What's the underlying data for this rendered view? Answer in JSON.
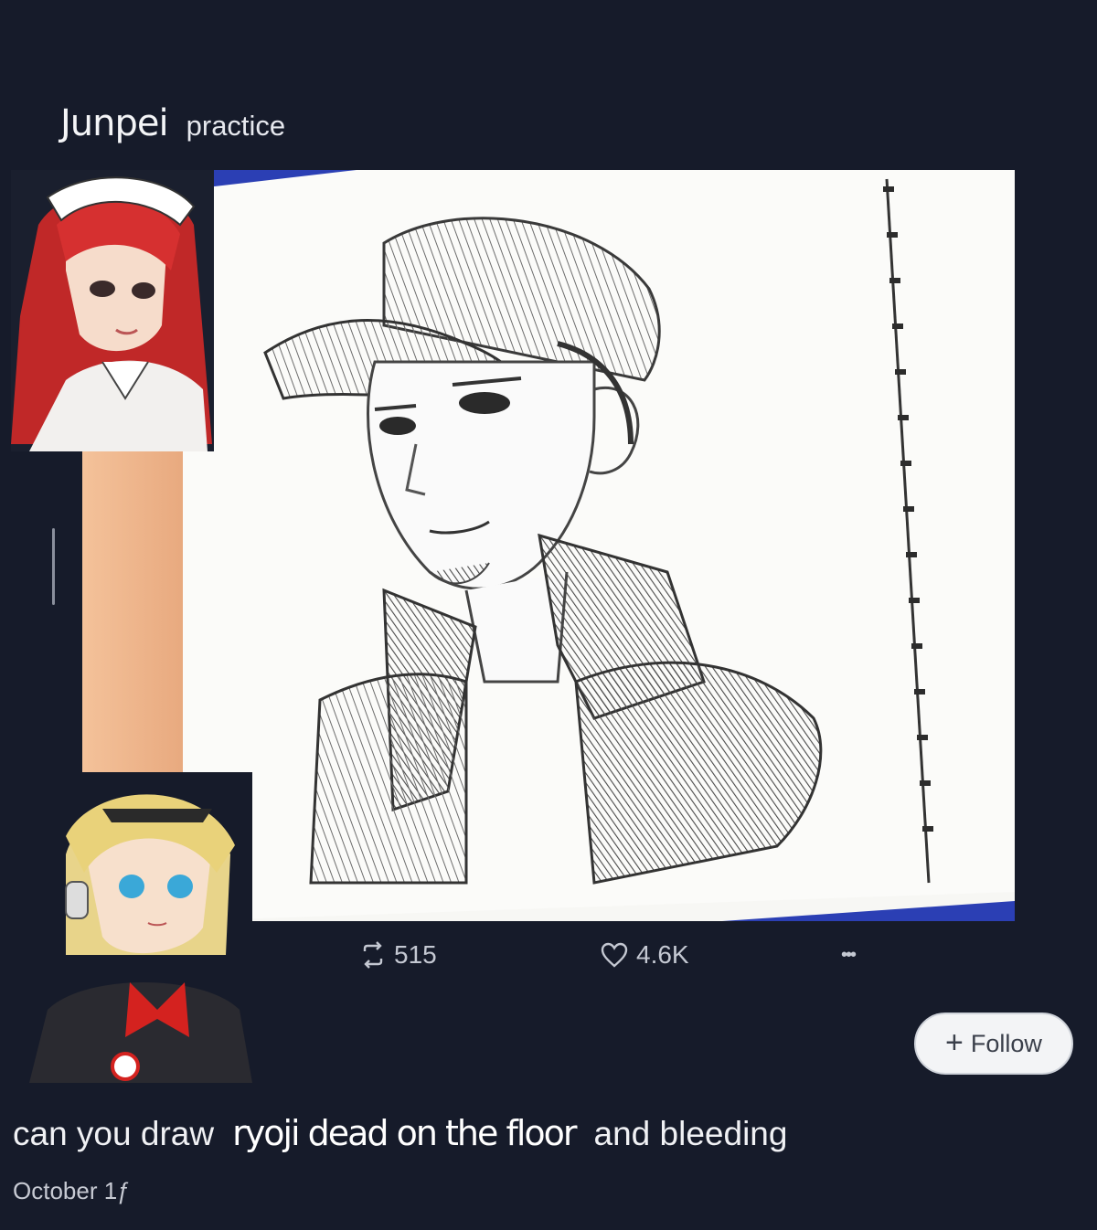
{
  "header": {
    "name": "Junpei",
    "label": "practice"
  },
  "post": {
    "image_alt": "pencil sketch of a young man in a baseball cap and high-collared jacket",
    "stats": {
      "reposts": "515",
      "likes": "4.6K",
      "more": "•••"
    }
  },
  "follow_button": {
    "icon": "+",
    "label": "Follow"
  },
  "comment": {
    "part1": "can you draw",
    "part2": "ryoji dead on the floor",
    "part3": "and bleeding",
    "date": "October 1ƒ"
  },
  "icons": [
    "repost-icon",
    "heart-icon",
    "more-icon",
    "plus-icon"
  ],
  "colors": {
    "background": "#161b2a",
    "accent_blue": "#2b3fb4",
    "button_bg": "#f3f4f6"
  }
}
